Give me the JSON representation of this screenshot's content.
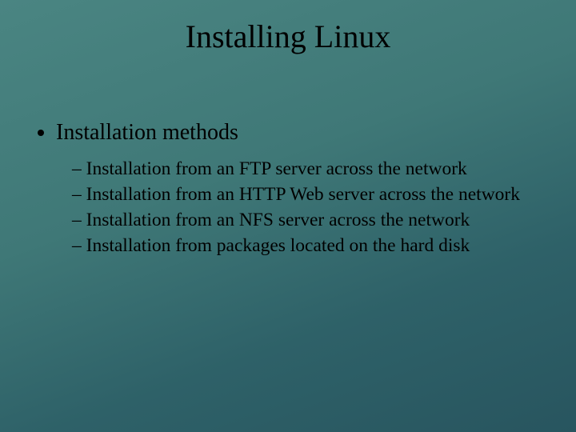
{
  "title": "Installing Linux",
  "top_bullet": "Installation methods",
  "sub_items": [
    "Installation from an FTP server across the network",
    "Installation from an HTTP Web server across the network",
    "Installation from an NFS server across the network",
    "Installation from packages located on the hard disk"
  ]
}
